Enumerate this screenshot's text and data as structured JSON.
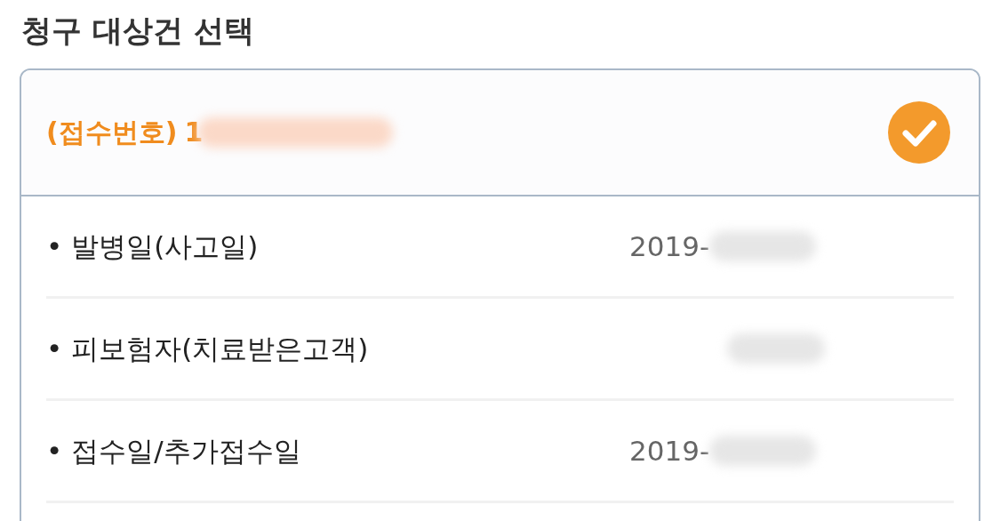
{
  "title": "청구 대상건 선택",
  "claim": {
    "receipt_label": "(접수번호)",
    "receipt_number": "1",
    "receipt_redacted": true,
    "selected": true,
    "rows": [
      {
        "label": "• 발병일(사고일)",
        "value": "2019-",
        "redacted": true
      },
      {
        "label": "• 피보험자(치료받은고객)",
        "redacted": true
      },
      {
        "label": "• 접수일/추가접수일",
        "value": "2019-",
        "redacted": true
      }
    ]
  }
}
